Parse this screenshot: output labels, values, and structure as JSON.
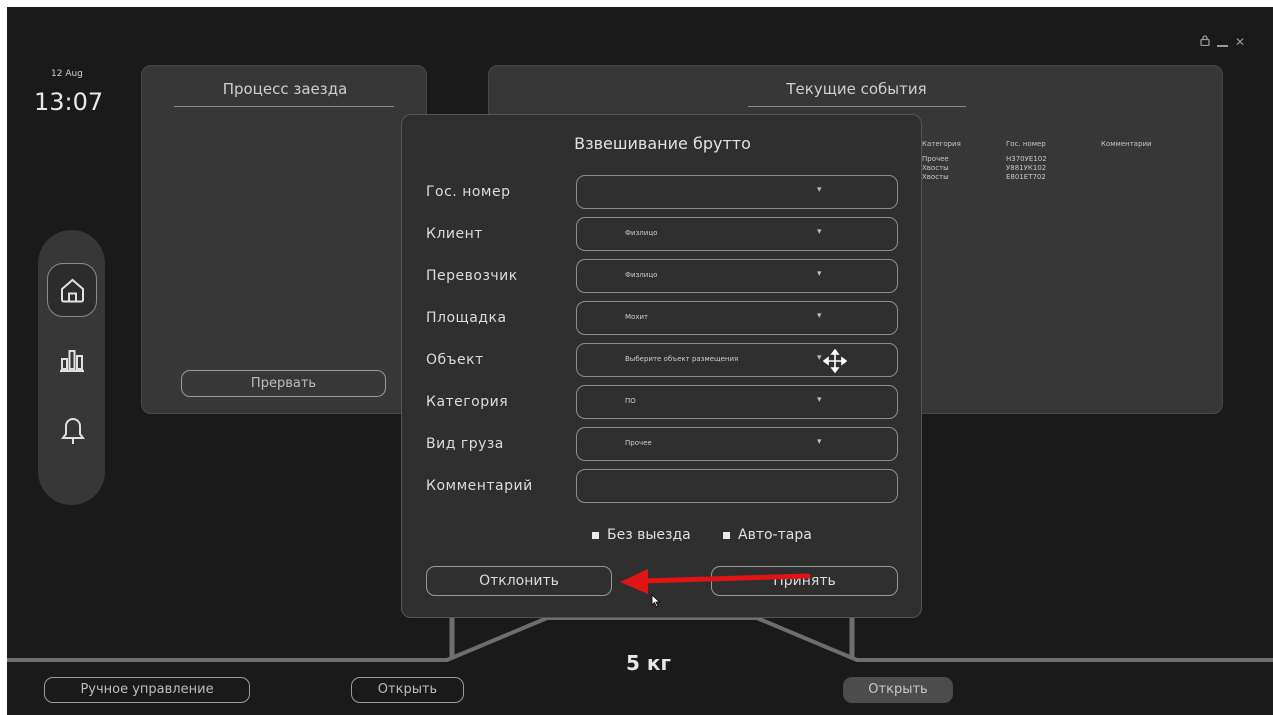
{
  "clock": {
    "date": "12 Aug",
    "time": "13:07"
  },
  "window_controls": {
    "lock": "🔒",
    "minimize": "—",
    "close": "✕"
  },
  "process_panel": {
    "title": "Процесс заезда",
    "abort_button": "Прервать"
  },
  "events_panel": {
    "title": "Текущие события",
    "columns": [
      "Категория",
      "Гос. номер",
      "Комментарии"
    ],
    "rows": [
      {
        "category": "Прочее",
        "plate": "Н370УЕ102"
      },
      {
        "category": "Хвосты",
        "plate": "У881УК102"
      },
      {
        "category": "Хвосты",
        "plate": "Е801ЕТ702"
      }
    ]
  },
  "modal": {
    "title": "Взвешивание брутто",
    "fields": [
      {
        "label": "Гос. номер",
        "value": ""
      },
      {
        "label": "Клиент",
        "value": "Физлицо"
      },
      {
        "label": "Перевозчик",
        "value": "Физлицо"
      },
      {
        "label": "Площадка",
        "value": "Мохит"
      },
      {
        "label": "Объект",
        "value": "Выберите объект размещения"
      },
      {
        "label": "Категория",
        "value": "ПО"
      },
      {
        "label": "Вид груза",
        "value": "Прочее"
      },
      {
        "label": "Комментарий",
        "value": ""
      }
    ],
    "checkbox_no_exit": "Без выезда",
    "checkbox_auto_tare": "Авто-тара",
    "decline_button": "Отклонить",
    "accept_button": "Принять"
  },
  "weight": "5 кг",
  "bottom": {
    "manual_control": "Ручное управление",
    "open_left": "Открыть",
    "open_right": "Открыть"
  },
  "colors": {
    "background": "#1a1a1a",
    "panel": "#373737",
    "modal": "#2f2f2f",
    "arrow": "#e01414"
  },
  "icons": {
    "cursor_move": "move-cursor-icon",
    "pointer": "mouse-pointer-icon"
  }
}
